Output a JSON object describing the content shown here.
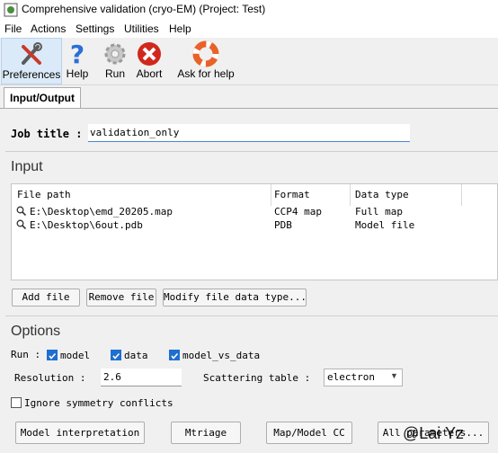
{
  "window": {
    "title": "Comprehensive validation (cryo-EM) (Project: Test)"
  },
  "menu": [
    "File",
    "Actions",
    "Settings",
    "Utilities",
    "Help"
  ],
  "toolbar": [
    {
      "label": "Preferences",
      "icon": "preferences-icon"
    },
    {
      "label": "Help",
      "icon": "help-icon"
    },
    {
      "label": "Run",
      "icon": "run-gear-icon"
    },
    {
      "label": "Abort",
      "icon": "abort-icon"
    },
    {
      "label": "Ask for help",
      "icon": "lifebuoy-icon"
    }
  ],
  "tabs": [
    {
      "label": "Input/Output",
      "active": true
    }
  ],
  "job": {
    "label": "Job title :",
    "value": "validation_only"
  },
  "input": {
    "heading": "Input",
    "columns": [
      "File path",
      "Format",
      "Data type"
    ],
    "rows": [
      {
        "path": "E:\\Desktop\\emd_20205.map",
        "format": "CCP4 map",
        "type": "Full map"
      },
      {
        "path": "E:\\Desktop\\6out.pdb",
        "format": "PDB",
        "type": "Model file"
      }
    ],
    "buttons": [
      "Add file",
      "Remove file",
      "Modify file data type..."
    ]
  },
  "options": {
    "heading": "Options",
    "run_label": "Run :",
    "run_checks": [
      {
        "label": "model",
        "checked": true
      },
      {
        "label": "data",
        "checked": true
      },
      {
        "label": "model_vs_data",
        "checked": true
      }
    ],
    "resolution_label": "Resolution :",
    "resolution_value": "2.6",
    "scattering_label": "Scattering table :",
    "scattering_value": "electron",
    "ignore_symmetry_label": "Ignore symmetry conflicts",
    "ignore_symmetry_checked": false,
    "buttons": [
      "Model interpretation",
      "Mtriage",
      "Map/Model CC",
      "All parameters..."
    ]
  },
  "watermark": "@Lai Yz",
  "colors": {
    "accent": "#1e6fd0",
    "selected_tool_bg": "#dbeaf8",
    "abort_red": "#d0281c",
    "help_blue": "#2a6fd6"
  }
}
